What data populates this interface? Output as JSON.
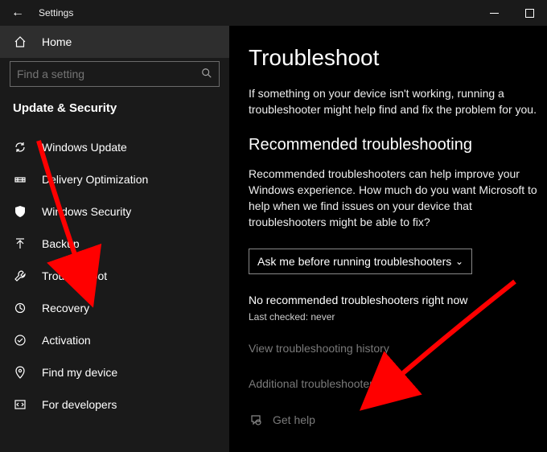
{
  "titlebar": {
    "back": "←",
    "appname": "Settings"
  },
  "sidebar": {
    "home": "Home",
    "search_placeholder": "Find a setting",
    "section": "Update & Security",
    "items": [
      {
        "label": "Windows Update"
      },
      {
        "label": "Delivery Optimization"
      },
      {
        "label": "Windows Security"
      },
      {
        "label": "Backup"
      },
      {
        "label": "Troubleshoot"
      },
      {
        "label": "Recovery"
      },
      {
        "label": "Activation"
      },
      {
        "label": "Find my device"
      },
      {
        "label": "For developers"
      }
    ]
  },
  "main": {
    "title": "Troubleshoot",
    "intro": "If something on your device isn't working, running a troubleshooter might help find and fix the problem for you.",
    "rec_heading": "Recommended troubleshooting",
    "rec_body": "Recommended troubleshooters can help improve your Windows experience. How much do you want Microsoft to help when we find issues on your device that troubleshooters might be able to fix?",
    "dropdown_value": "Ask me before running troubleshooters",
    "no_rec": "No recommended troubleshooters right now",
    "last_checked": "Last checked: never",
    "history_link": "View troubleshooting history",
    "additional_link": "Additional troubleshooters",
    "get_help": "Get help"
  }
}
